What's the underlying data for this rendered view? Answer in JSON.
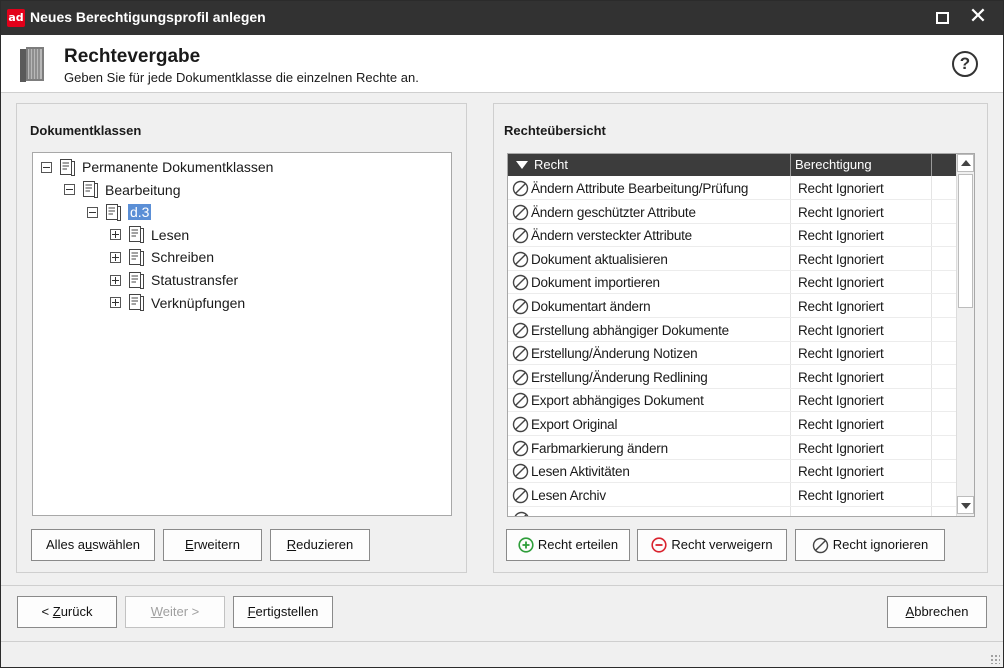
{
  "window": {
    "app_icon": "ad",
    "title": "Neues Berechtigungsprofil anlegen",
    "maximize_icon": "maximize-icon",
    "close_symbol": "✕"
  },
  "header": {
    "title": "Rechtevergabe",
    "subtitle": "Geben Sie für jede Dokumentklasse die einzelnen Rechte an.",
    "help_symbol": "?"
  },
  "left_panel": {
    "title": "Dokumentklassen",
    "tree": [
      {
        "label": "Permanente Dokumentklassen",
        "expander": "minus",
        "selected": false
      },
      {
        "label": "Bearbeitung",
        "expander": "minus",
        "selected": false
      },
      {
        "label": "d.3",
        "expander": "minus",
        "selected": true
      },
      {
        "label": "Lesen",
        "expander": "plus",
        "selected": false
      },
      {
        "label": "Schreiben",
        "expander": "plus",
        "selected": false
      },
      {
        "label": "Statustransfer",
        "expander": "plus",
        "selected": false
      },
      {
        "label": "Verknüpfungen",
        "expander": "plus",
        "selected": false
      }
    ],
    "buttons": {
      "select_all_pre": "Alles a",
      "select_all_key": "u",
      "select_all_post": "swählen",
      "expand_key": "E",
      "expand_post": "rweitern",
      "reduce_key": "R",
      "reduce_post": "eduzieren"
    }
  },
  "right_panel": {
    "title": "Rechteübersicht",
    "columns": {
      "recht": "Recht",
      "berechtigung": "Berechtigung"
    },
    "rows": [
      {
        "recht": "Ändern Attribute Bearbeitung/Prüfung",
        "berechtigung": "Recht Ignoriert"
      },
      {
        "recht": "Ändern geschützter Attribute",
        "berechtigung": "Recht Ignoriert"
      },
      {
        "recht": "Ändern versteckter Attribute",
        "berechtigung": "Recht Ignoriert"
      },
      {
        "recht": "Dokument aktualisieren",
        "berechtigung": "Recht Ignoriert"
      },
      {
        "recht": "Dokument importieren",
        "berechtigung": "Recht Ignoriert"
      },
      {
        "recht": "Dokumentart ändern",
        "berechtigung": "Recht Ignoriert"
      },
      {
        "recht": "Erstellung abhängiger Dokumente",
        "berechtigung": "Recht Ignoriert"
      },
      {
        "recht": "Erstellung/Änderung Notizen",
        "berechtigung": "Recht Ignoriert"
      },
      {
        "recht": "Erstellung/Änderung Redlining",
        "berechtigung": "Recht Ignoriert"
      },
      {
        "recht": "Export abhängiges Dokument",
        "berechtigung": "Recht Ignoriert"
      },
      {
        "recht": "Export Original",
        "berechtigung": "Recht Ignoriert"
      },
      {
        "recht": "Farbmarkierung ändern",
        "berechtigung": "Recht Ignoriert"
      },
      {
        "recht": "Lesen Aktivitäten",
        "berechtigung": "Recht Ignoriert"
      },
      {
        "recht": "Lesen Archiv",
        "berechtigung": "Recht Ignoriert"
      }
    ],
    "buttons": {
      "grant": "Recht erteilen",
      "deny": "Recht verweigern",
      "ignore": "Recht ignorieren"
    }
  },
  "footer": {
    "back_pre": "< ",
    "back_key": "Z",
    "back_post": "urück",
    "next_key": "W",
    "next_post": "eiter >",
    "finish_key": "F",
    "finish_post": "ertigstellen",
    "cancel_key": "A",
    "cancel_post": "bbrechen"
  },
  "colors": {
    "titlebar": "#323232",
    "brand_red": "#e2001a",
    "selection": "#5b8fd6",
    "grant_green": "#2e9e3a",
    "deny_red": "#d9232e"
  }
}
